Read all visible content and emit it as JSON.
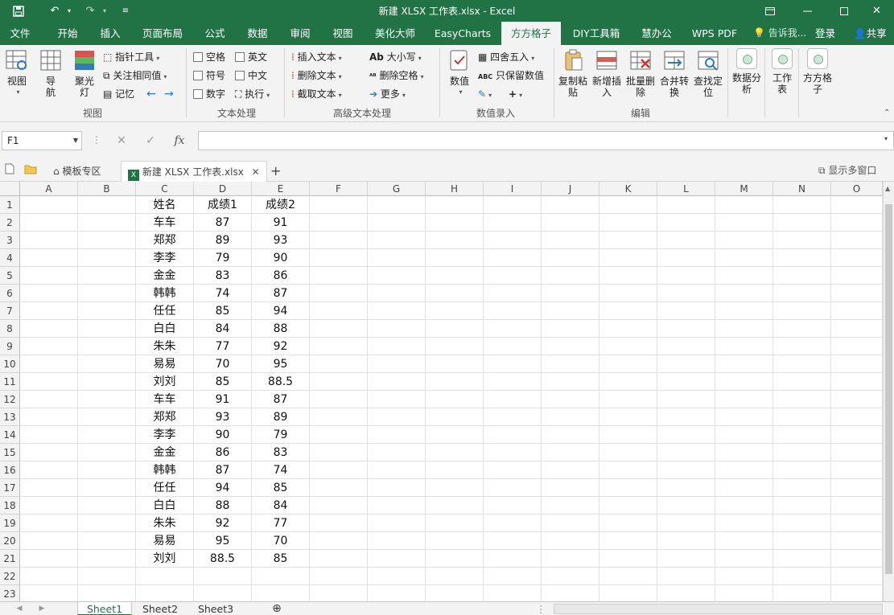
{
  "window": {
    "title": "新建 XLSX 工作表.xlsx - Excel"
  },
  "ribbon_tabs": [
    "文件",
    "开始",
    "插入",
    "页面布局",
    "公式",
    "数据",
    "审阅",
    "视图",
    "美化大师",
    "EasyCharts",
    "方方格子",
    "DIY工具箱",
    "慧办公",
    "WPS PDF"
  ],
  "active_tab": "方方格子",
  "tell_me": "告诉我...",
  "login": "登录",
  "share": "共享",
  "ribbon": {
    "view_group": {
      "label": "视图",
      "btn_view": "视图",
      "btn_nav": "导航",
      "btn_spotlight": "聚光灯",
      "btn_pointer": "指针工具",
      "btn_related": "关注相同值",
      "btn_memo": "记忆"
    },
    "text_group": {
      "label": "文本处理",
      "space": "空格",
      "english": "英文",
      "symbol": "符号",
      "chinese": "中文",
      "number": "数字",
      "execute": "执行"
    },
    "adv_text_group": {
      "label": "高级文本处理",
      "insert_text": "插入文本",
      "delete_text": "删除文本",
      "cut_text": "截取文本",
      "case": "大小写",
      "remove_space": "删除空格",
      "more": "更多"
    },
    "num_group": {
      "label": "数值录入",
      "value": "数值",
      "round": "四舍五入",
      "keep_value": "只保留数值"
    },
    "edit_group": {
      "label": "编辑",
      "copy_paste": "复制粘贴",
      "new_insert": "新增插入",
      "batch_delete": "批量删除",
      "merge_convert": "合并转换",
      "find_locate": "查找定位"
    },
    "data_analysis": "数据分析",
    "worksheet": "工作表",
    "ffgz": "方方格子"
  },
  "formula_bar": {
    "name_box": "F1",
    "formula": ""
  },
  "doc_tabs": {
    "template": "模板专区",
    "file": "新建 XLSX 工作表.xlsx",
    "multi_window": "显示多窗口"
  },
  "columns": [
    "A",
    "B",
    "C",
    "D",
    "E",
    "F",
    "G",
    "H",
    "I",
    "J",
    "K",
    "L",
    "M",
    "N",
    "O"
  ],
  "rows": [
    [
      "姓名",
      "成绩1",
      "成绩2"
    ],
    [
      "车车",
      "87",
      "91"
    ],
    [
      "郑郑",
      "89",
      "93"
    ],
    [
      "李李",
      "79",
      "90"
    ],
    [
      "金金",
      "83",
      "86"
    ],
    [
      "韩韩",
      "74",
      "87"
    ],
    [
      "任任",
      "85",
      "94"
    ],
    [
      "白白",
      "84",
      "88"
    ],
    [
      "朱朱",
      "77",
      "92"
    ],
    [
      "易易",
      "70",
      "95"
    ],
    [
      "刘刘",
      "85",
      "88.5"
    ],
    [
      "车车",
      "91",
      "87"
    ],
    [
      "郑郑",
      "93",
      "89"
    ],
    [
      "李李",
      "90",
      "79"
    ],
    [
      "金金",
      "86",
      "83"
    ],
    [
      "韩韩",
      "87",
      "74"
    ],
    [
      "任任",
      "94",
      "85"
    ],
    [
      "白白",
      "88",
      "84"
    ],
    [
      "朱朱",
      "92",
      "77"
    ],
    [
      "易易",
      "95",
      "70"
    ],
    [
      "刘刘",
      "88.5",
      "85"
    ],
    [
      "",
      "",
      ""
    ],
    [
      "",
      "",
      ""
    ]
  ],
  "sheets": [
    "Sheet1",
    "Sheet2",
    "Sheet3"
  ],
  "active_sheet": "Sheet1",
  "colors": {
    "accent": "#217346"
  }
}
